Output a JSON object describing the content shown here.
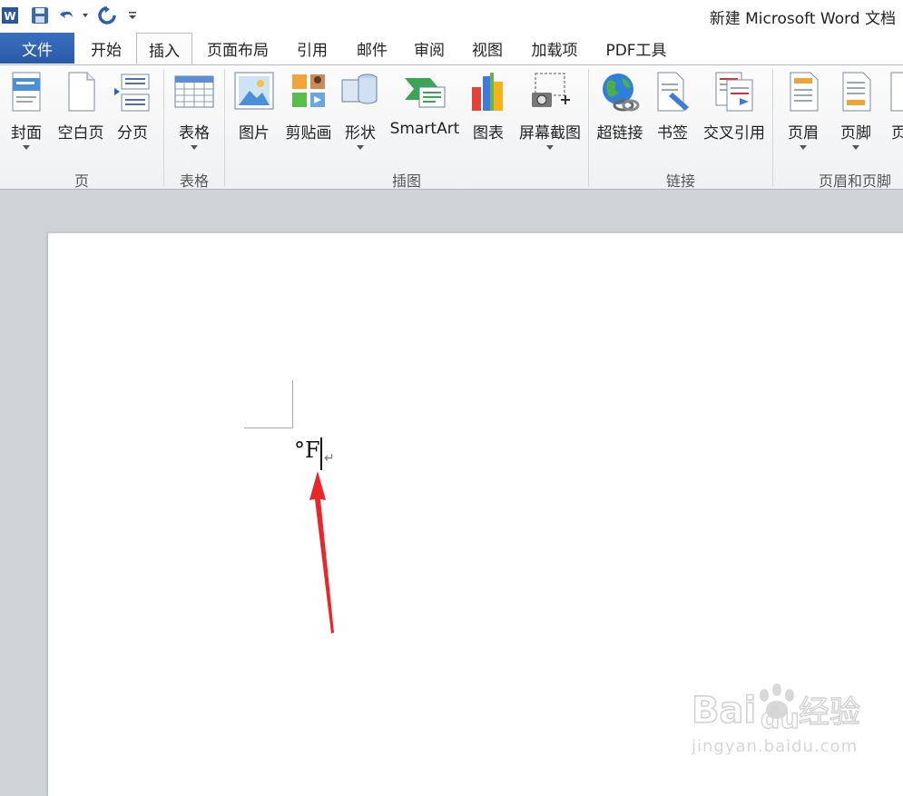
{
  "window": {
    "title": "新建 Microsoft Word 文档"
  },
  "qat": {
    "app_icon": "word-app-icon",
    "save": "save-icon",
    "undo": "undo-icon",
    "redo": "redo-icon",
    "customize": "customize-qat-icon"
  },
  "tabs": [
    {
      "label": "文件"
    },
    {
      "label": "开始"
    },
    {
      "label": "插入"
    },
    {
      "label": "页面布局"
    },
    {
      "label": "引用"
    },
    {
      "label": "邮件"
    },
    {
      "label": "审阅"
    },
    {
      "label": "视图"
    },
    {
      "label": "加载项"
    },
    {
      "label": "PDF工具"
    }
  ],
  "ribbon": {
    "groups": [
      {
        "label": "页",
        "buttons": [
          {
            "label": "封面"
          },
          {
            "label": "空白页"
          },
          {
            "label": "分页"
          }
        ]
      },
      {
        "label": "表格",
        "buttons": [
          {
            "label": "表格"
          }
        ]
      },
      {
        "label": "插图",
        "buttons": [
          {
            "label": "图片"
          },
          {
            "label": "剪贴画"
          },
          {
            "label": "形状"
          },
          {
            "label": "SmartArt"
          },
          {
            "label": "图表"
          },
          {
            "label": "屏幕截图"
          }
        ]
      },
      {
        "label": "链接",
        "buttons": [
          {
            "label": "超链接"
          },
          {
            "label": "书签"
          },
          {
            "label": "交叉引用"
          }
        ]
      },
      {
        "label": "页眉和页脚",
        "buttons": [
          {
            "label": "页眉"
          },
          {
            "label": "页脚"
          },
          {
            "label": "页"
          }
        ]
      }
    ]
  },
  "document": {
    "text": "°F",
    "paragraph_mark": "↵"
  },
  "colors": {
    "file_tab": "#2b579a",
    "arrow": "#e8262b"
  },
  "watermark": {
    "brand": "Baidu经验",
    "url": "jingyan.baidu.com"
  }
}
